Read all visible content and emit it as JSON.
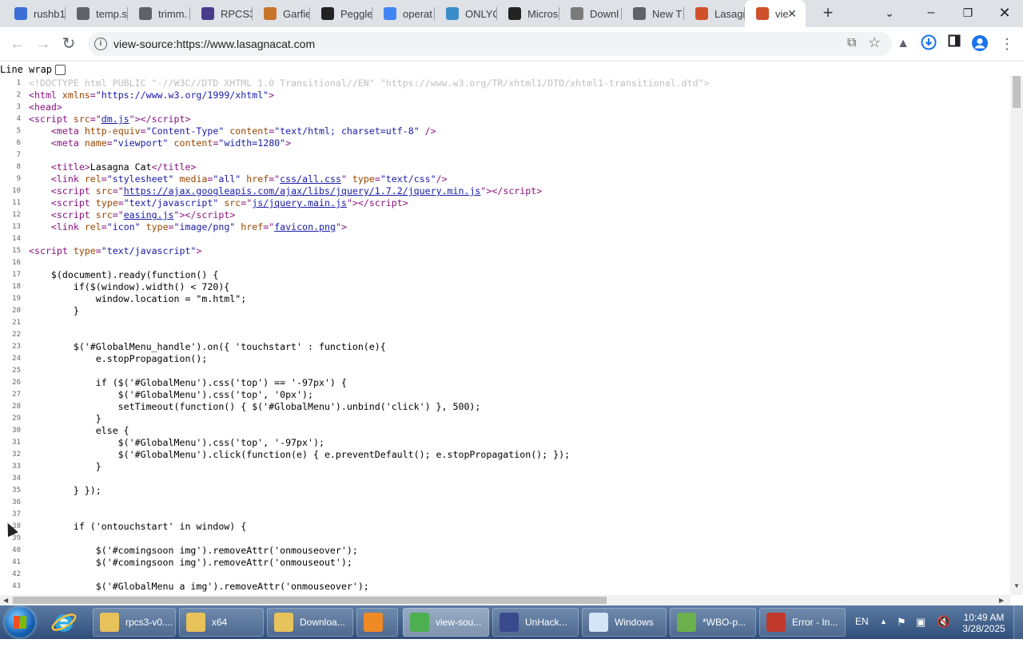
{
  "tabs": [
    {
      "title": "rushb1",
      "icon": "favicon-icon",
      "color": "#3b6fd8"
    },
    {
      "title": "temp.s",
      "icon": "chromium-icon",
      "color": "#5f6368"
    },
    {
      "title": "trimm.",
      "icon": "chromium-icon",
      "color": "#5f6368"
    },
    {
      "title": "RPCS3",
      "icon": "rpcs3-icon",
      "color": "#4a3c8c"
    },
    {
      "title": "Garfiel",
      "icon": "garfield-icon",
      "color": "#c7742b"
    },
    {
      "title": "Peggle",
      "icon": "library-icon",
      "color": "#222222"
    },
    {
      "title": "operat",
      "icon": "google-icon",
      "color": "#4285f4"
    },
    {
      "title": "ONLYC",
      "icon": "layers-icon",
      "color": "#3a8dc9"
    },
    {
      "title": "Micros",
      "icon": "library-icon",
      "color": "#222222"
    },
    {
      "title": "Downl",
      "icon": "gear-icon",
      "color": "#7a7a7a"
    },
    {
      "title": "New T",
      "icon": "chromium-icon",
      "color": "#5f6368"
    },
    {
      "title": "Lasagn",
      "icon": "lasagna-icon",
      "color": "#d0502a"
    },
    {
      "title": "vie",
      "icon": "lasagna-icon",
      "color": "#d0502a",
      "active": true
    }
  ],
  "toolbar": {
    "url": "view-source:https://www.lasagnacat.com"
  },
  "viewer": {
    "line_wrap_label": "Line wrap",
    "line_wrap_checked": false
  },
  "source_lines": [
    {
      "n": "1",
      "html": "<span class='d'>&lt;!DOCTYPE html PUBLIC \"-//W3C//DTD XHTML 1.0 Transitional//EN\" \"https://www.w3.org/TR/xhtml1/DTD/xhtml1-transitional.dtd\"&gt;</span>"
    },
    {
      "n": "2",
      "html": "<span class='t'>&lt;html </span><span class='a'>xmlns</span><span class='t'>=</span><span class='v'>\"https://www.w3.org/1999/xhtml\"</span><span class='t'>&gt;</span>"
    },
    {
      "n": "3",
      "html": "<span class='t'>&lt;head&gt;</span>"
    },
    {
      "n": "4",
      "html": "<span class='t'>&lt;script </span><span class='a'>src</span><span class='t'>=\"</span><span class='lnk'>dm.js</span><span class='t'>\"&gt;&lt;/script&gt;</span>"
    },
    {
      "n": "5",
      "html": "    <span class='t'>&lt;meta </span><span class='a'>http-equiv</span><span class='t'>=</span><span class='v'>\"Content-Type\"</span><span class='t'> </span><span class='a'>content</span><span class='t'>=</span><span class='v'>\"text/html; charset=utf-8\"</span><span class='t'> /&gt;</span>"
    },
    {
      "n": "6",
      "html": "    <span class='t'>&lt;meta </span><span class='a'>name</span><span class='t'>=</span><span class='v'>\"viewport\"</span><span class='t'> </span><span class='a'>content</span><span class='t'>=</span><span class='v'>\"width=1280\"</span><span class='t'>&gt;</span>"
    },
    {
      "n": "7",
      "html": ""
    },
    {
      "n": "8",
      "html": "    <span class='t'>&lt;title&gt;</span>Lasagna Cat<span class='t'>&lt;/title&gt;</span>"
    },
    {
      "n": "9",
      "html": "    <span class='t'>&lt;link </span><span class='a'>rel</span><span class='t'>=</span><span class='v'>\"stylesheet\"</span><span class='t'> </span><span class='a'>media</span><span class='t'>=</span><span class='v'>\"all\"</span><span class='t'> </span><span class='a'>href</span><span class='t'>=\"</span><span class='lnk'>css/all.css</span><span class='t'>\" </span><span class='a'>type</span><span class='t'>=</span><span class='v'>\"text/css\"</span><span class='t'>/&gt;</span>"
    },
    {
      "n": "10",
      "html": "    <span class='t'>&lt;script </span><span class='a'>src</span><span class='t'>=\"</span><span class='lnk'>https://ajax.googleapis.com/ajax/libs/jquery/1.7.2/jquery.min.js</span><span class='t'>\"&gt;&lt;/script&gt;</span>"
    },
    {
      "n": "11",
      "html": "    <span class='t'>&lt;script </span><span class='a'>type</span><span class='t'>=</span><span class='v'>\"text/javascript\"</span><span class='t'> </span><span class='a'>src</span><span class='t'>=\"</span><span class='lnk'>js/jquery.main.js</span><span class='t'>\"&gt;&lt;/script&gt;</span>"
    },
    {
      "n": "12",
      "html": "    <span class='t'>&lt;script </span><span class='a'>src</span><span class='t'>=\"</span><span class='lnk'>easing.js</span><span class='t'>\"&gt;&lt;/script&gt;</span>"
    },
    {
      "n": "13",
      "html": "    <span class='t'>&lt;link </span><span class='a'>rel</span><span class='t'>=</span><span class='v'>\"icon\"</span><span class='t'> </span><span class='a'>type</span><span class='t'>=</span><span class='v'>\"image/png\"</span><span class='t'> </span><span class='a'>href</span><span class='t'>=\"</span><span class='lnk'>favicon.png</span><span class='t'>\"&gt;</span>"
    },
    {
      "n": "14",
      "html": ""
    },
    {
      "n": "15",
      "html": "<span class='t'>&lt;script </span><span class='a'>type</span><span class='t'>=</span><span class='v'>\"text/javascript\"</span><span class='t'>&gt;</span>"
    },
    {
      "n": "16",
      "html": ""
    },
    {
      "n": "17",
      "html": "    $(document).ready(function() {"
    },
    {
      "n": "18",
      "html": "        if($(window).width() &lt; 720){"
    },
    {
      "n": "19",
      "html": "            window.location = \"m.html\";"
    },
    {
      "n": "20",
      "html": "        }"
    },
    {
      "n": "21",
      "html": ""
    },
    {
      "n": "22",
      "html": ""
    },
    {
      "n": "23",
      "html": "        $('#GlobalMenu_handle').on({ 'touchstart' : function(e){"
    },
    {
      "n": "24",
      "html": "            e.stopPropagation();"
    },
    {
      "n": "25",
      "html": ""
    },
    {
      "n": "26",
      "html": "            if ($('#GlobalMenu').css('top') == '-97px') {"
    },
    {
      "n": "27",
      "html": "                $('#GlobalMenu').css('top', '0px');"
    },
    {
      "n": "28",
      "html": "                setTimeout(function() { $('#GlobalMenu').unbind('click') }, 500);"
    },
    {
      "n": "29",
      "html": "            }"
    },
    {
      "n": "30",
      "html": "            else {"
    },
    {
      "n": "31",
      "html": "                $('#GlobalMenu').css('top', '-97px');"
    },
    {
      "n": "32",
      "html": "                $('#GlobalMenu').click(function(e) { e.preventDefault(); e.stopPropagation(); });"
    },
    {
      "n": "33",
      "html": "            }"
    },
    {
      "n": "34",
      "html": ""
    },
    {
      "n": "35",
      "html": "        } });"
    },
    {
      "n": "36",
      "html": ""
    },
    {
      "n": "37",
      "html": ""
    },
    {
      "n": "38",
      "html": "        if ('ontouchstart' in window) {"
    },
    {
      "n": "39",
      "html": ""
    },
    {
      "n": "40",
      "html": "            $('#comingsoon img').removeAttr('onmouseover');"
    },
    {
      "n": "41",
      "html": "            $('#comingsoon img').removeAttr('onmouseout');"
    },
    {
      "n": "42",
      "html": ""
    },
    {
      "n": "43",
      "html": "            $('#GlobalMenu a img').removeAttr('onmouseover');"
    }
  ],
  "taskbar": {
    "tasks": [
      {
        "label": "rpcs3-v0....",
        "icon": "folder-icon",
        "color": "#e8c25a"
      },
      {
        "label": "x64",
        "icon": "folder-icon",
        "color": "#e8c25a"
      },
      {
        "label": "Downloa...",
        "icon": "downloads-folder-icon",
        "color": "#e8c25a"
      },
      {
        "label": "",
        "icon": "media-player-icon",
        "color": "#f08a24"
      },
      {
        "label": "view-sou...",
        "icon": "chrome-icon",
        "color": "#4caf50",
        "active": true
      },
      {
        "label": "UnHack...",
        "icon": "app-icon",
        "color": "#3b4a8c"
      },
      {
        "label": "Windows",
        "icon": "document-icon",
        "color": "#d6e4f7"
      },
      {
        "label": "*WBO-p...",
        "icon": "notepad-icon",
        "color": "#6ab04c"
      },
      {
        "label": "Error - In...",
        "icon": "error-app-icon",
        "color": "#c0392b"
      }
    ],
    "lang": "EN",
    "time": "10:49 AM",
    "date": "3/28/2025"
  }
}
